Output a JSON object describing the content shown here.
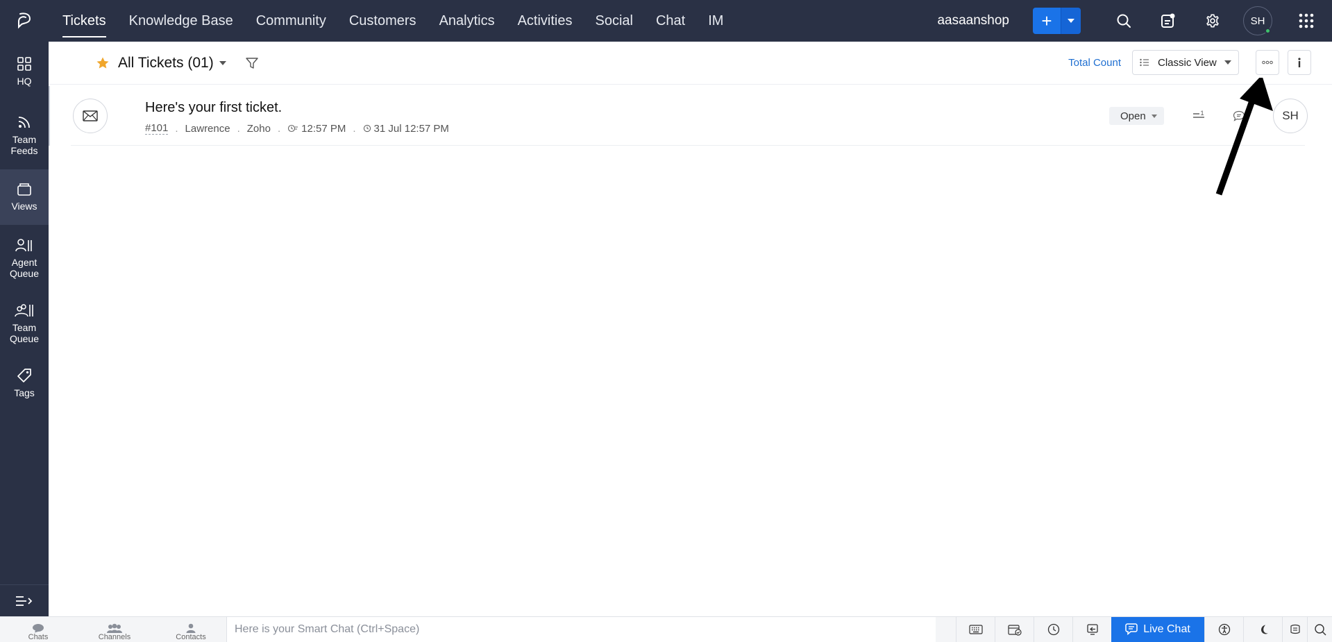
{
  "top_nav": {
    "items": [
      {
        "label": "Tickets",
        "active": true
      },
      {
        "label": "Knowledge Base"
      },
      {
        "label": "Community"
      },
      {
        "label": "Customers"
      },
      {
        "label": "Analytics"
      },
      {
        "label": "Activities"
      },
      {
        "label": "Social"
      },
      {
        "label": "Chat"
      },
      {
        "label": "IM"
      }
    ],
    "org_name": "aasaanshop",
    "add_label": "+",
    "avatar_initials": "SH"
  },
  "sidebar": {
    "items": [
      {
        "label": "HQ",
        "icon": "grid-icon"
      },
      {
        "label": "Team Feeds",
        "icon": "feed-icon"
      },
      {
        "label": "Views",
        "icon": "views-icon",
        "active": true
      },
      {
        "label": "Agent Queue",
        "icon": "agent-queue-icon"
      },
      {
        "label": "Team Queue",
        "icon": "team-queue-icon"
      },
      {
        "label": "Tags",
        "icon": "tag-icon"
      }
    ]
  },
  "toolbar": {
    "view_title": "All Tickets (01)",
    "total_count_label": "Total Count",
    "view_mode": "Classic View"
  },
  "tickets": [
    {
      "subject": "Here's your first ticket.",
      "id": "#101",
      "contact": "Lawrence",
      "account": "Zoho",
      "due_time": "12:57 PM",
      "created": "31 Jul 12:57 PM",
      "status": "Open",
      "priority_badge": "=1",
      "assignee_initials": "SH"
    }
  ],
  "bottom_bar": {
    "tabs": [
      "Chats",
      "Channels",
      "Contacts"
    ],
    "smart_chat_placeholder": "Here is your Smart Chat (Ctrl+Space)",
    "live_chat_label": "Live Chat"
  },
  "colors": {
    "nav_bg": "#2a3145",
    "accent": "#1a73e8",
    "star": "#f0a62c"
  }
}
